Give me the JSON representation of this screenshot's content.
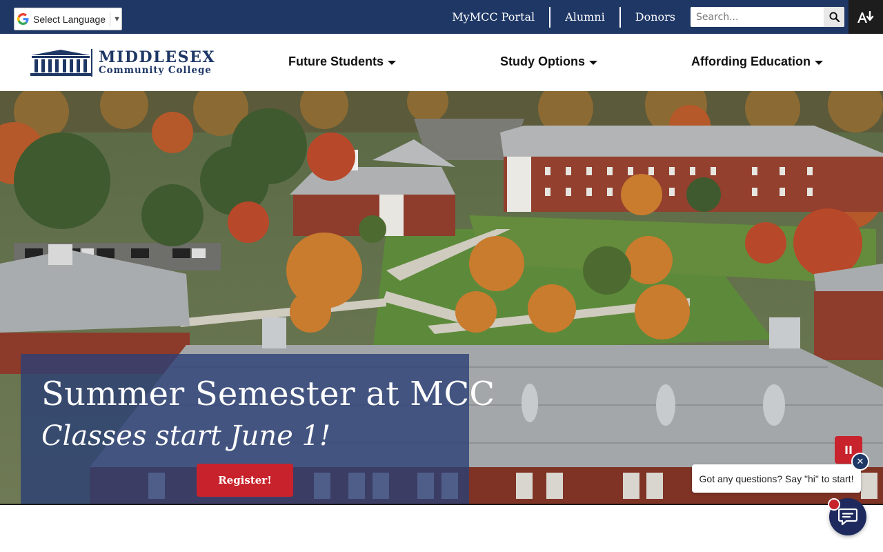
{
  "utility": {
    "language_label": "Select Language",
    "links": [
      "MyMCC Portal",
      "Alumni",
      "Donors"
    ],
    "search_placeholder": "Search...",
    "search_icon": "search-icon",
    "accessibility_icon": "text-size-icon"
  },
  "logo": {
    "line1": "MIDDLESEX",
    "line2": "Community College"
  },
  "nav": {
    "items": [
      "Future Students",
      "Study Options",
      "Affording Education"
    ]
  },
  "hero": {
    "title": "Summer Semester at MCC",
    "subtitle": "Classes start June 1!",
    "cta": "Register!",
    "pause_icon": "pause-icon"
  },
  "chat": {
    "prompt": "Got any questions? Say \"hi\" to start!",
    "close_icon": "close-icon",
    "launcher_icon": "chat-icon"
  },
  "colors": {
    "navy": "#1e3765",
    "red": "#c8232c",
    "white": "#ffffff"
  }
}
